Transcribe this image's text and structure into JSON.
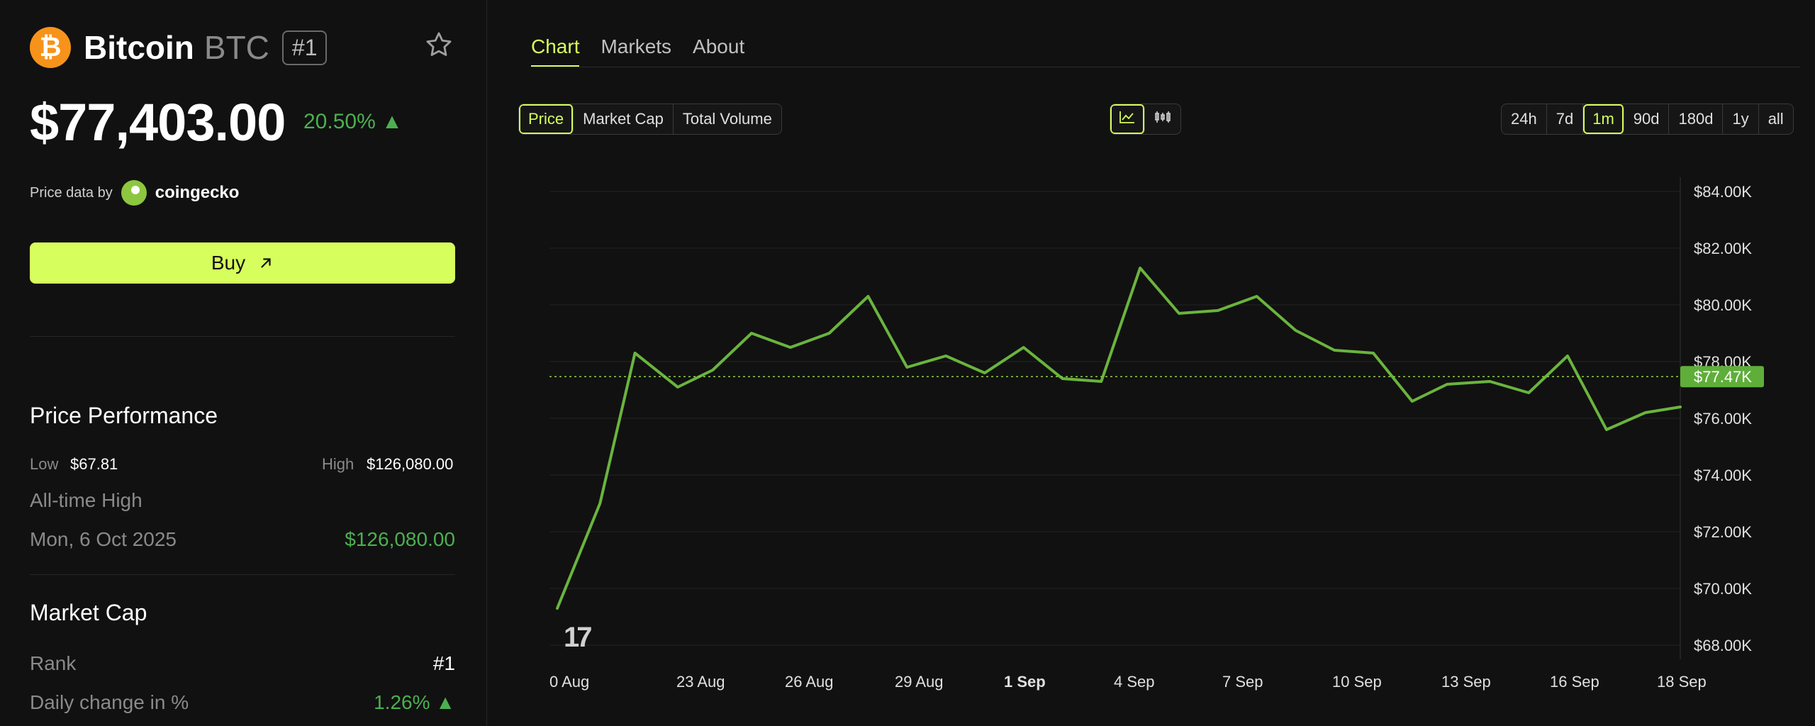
{
  "coin": {
    "logo_symbol": "₿",
    "name": "Bitcoin",
    "symbol": "BTC",
    "rank_badge": "#1",
    "price": "$77,403.00",
    "change_24h": "20.50% ▲",
    "price_data_by_label": "Price data by",
    "provider": "coingecko"
  },
  "buy": {
    "label": "Buy",
    "icon": "arrow-up-right-icon"
  },
  "price_performance": {
    "title": "Price Performance",
    "low_label": "Low",
    "low_value": "$67.81",
    "high_label": "High",
    "high_value": "$126,080.00",
    "ath_label": "All-time High",
    "ath_date": "Mon, 6 Oct 2025",
    "ath_value": "$126,080.00"
  },
  "market_cap": {
    "title": "Market Cap",
    "rank_label": "Rank",
    "rank_value": "#1",
    "daily_change_label": "Daily change in %",
    "daily_change_value": "1.26% ▲"
  },
  "tabs": [
    "Chart",
    "Markets",
    "About"
  ],
  "active_tab": "Chart",
  "metric_options": [
    "Price",
    "Market Cap",
    "Total Volume"
  ],
  "active_metric": "Price",
  "chart_style_options": [
    "line-chart-icon",
    "candlestick-icon"
  ],
  "ranges": [
    "24h",
    "7d",
    "1m",
    "90d",
    "180d",
    "1y",
    "all"
  ],
  "active_range": "1m",
  "colors": {
    "accent": "#d6fe5c",
    "line": "#6ab43e",
    "positive": "#4caf50",
    "bg": "#111111"
  },
  "chart_data": {
    "type": "line",
    "x_ticks": [
      "0 Aug",
      "23 Aug",
      "26 Aug",
      "29 Aug",
      "1 Sep",
      "4 Sep",
      "7 Sep",
      "10 Sep",
      "13 Sep",
      "16 Sep",
      "18 Sep"
    ],
    "y_ticks": [
      "$84.00K",
      "$82.00K",
      "$80.00K",
      "$78.00K",
      "$76.00K",
      "$74.00K",
      "$72.00K",
      "$70.00K",
      "$68.00K"
    ],
    "ylim": [
      67.5,
      84.5
    ],
    "x_range": [
      20.2,
      49.3
    ],
    "current_label": "$77.47K",
    "current_value": 77.47,
    "grid": true,
    "series": [
      {
        "x": [
          20.4,
          21.5,
          22.4,
          23.5,
          24.4,
          25.4,
          26.4,
          27.4,
          28.4,
          29.4,
          30.4,
          31.4,
          32.4,
          33.4,
          34.4,
          35.4,
          36.4,
          37.4,
          38.4,
          39.4,
          40.4,
          41.4,
          42.4,
          43.3,
          44.4,
          45.4,
          46.4,
          47.4,
          48.4,
          49.3
        ],
        "y": [
          69.3,
          73.0,
          78.3,
          77.1,
          77.7,
          79.0,
          78.5,
          79.0,
          80.3,
          77.8,
          78.2,
          77.6,
          78.5,
          77.4,
          77.3,
          81.3,
          79.7,
          79.8,
          80.3,
          79.1,
          78.4,
          78.3,
          76.6,
          77.2,
          77.3,
          76.9,
          78.2,
          75.6,
          76.2,
          76.4
        ]
      }
    ],
    "watermark": "17"
  }
}
